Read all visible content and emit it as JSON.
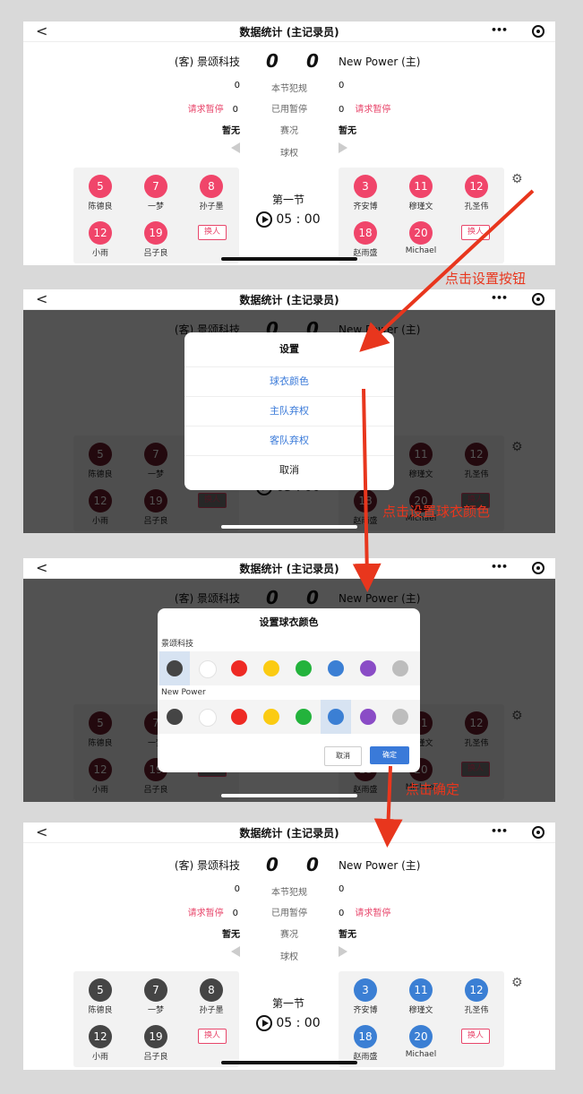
{
  "nav": {
    "back": "<",
    "title": "数据统计 (主记录员)",
    "more": "•••"
  },
  "game": {
    "away_name": "(客) 景颂科技",
    "home_name": "New Power (主)",
    "away_score": "0",
    "home_score": "0",
    "fouls_label": "本节犯规",
    "away_fouls": "0",
    "home_fouls": "0",
    "timeout_label": "已用暂停",
    "away_timeouts": "0",
    "home_timeouts": "0",
    "request_timeout": "请求暂停",
    "status_label": "赛况",
    "away_status": "暂无",
    "home_status": "暂无",
    "possession_label": "球权",
    "period": "第一节",
    "clock": "05 : 00",
    "sub_label": "换人",
    "away_players": [
      {
        "num": "5",
        "name": "陈德良"
      },
      {
        "num": "7",
        "name": "一梦"
      },
      {
        "num": "8",
        "name": "孙子墨"
      },
      {
        "num": "12",
        "name": "小雨"
      },
      {
        "num": "19",
        "name": "吕子良"
      }
    ],
    "home_players": [
      {
        "num": "3",
        "name": "齐安博"
      },
      {
        "num": "11",
        "name": "穆瑾文"
      },
      {
        "num": "12",
        "name": "孔圣伟"
      },
      {
        "num": "18",
        "name": "赵雨盛"
      },
      {
        "num": "20",
        "name": "Michael"
      }
    ]
  },
  "settings_dialog": {
    "title": "设置",
    "jersey_color": "球衣颜色",
    "home_forfeit": "主队弃权",
    "away_forfeit": "客队弃权",
    "cancel": "取消"
  },
  "color_dialog": {
    "title": "设置球衣颜色",
    "team1": "景颂科技",
    "team2": "New Power",
    "colors": [
      "#454545",
      "#ffffff",
      "#ee2a24",
      "#fbcb12",
      "#23b33c",
      "#3b7fd4",
      "#8a4cc6",
      "#bdbdbd"
    ],
    "cancel": "取消",
    "confirm": "确定"
  },
  "annotations": {
    "step1": "点击设置按钮",
    "step2": "点击设置球衣颜色",
    "step3": "点击确定"
  },
  "theme": {
    "red": "#f0456a",
    "dark": "#454545",
    "blue": "#3b7fd4",
    "accent": "#e8361d"
  }
}
